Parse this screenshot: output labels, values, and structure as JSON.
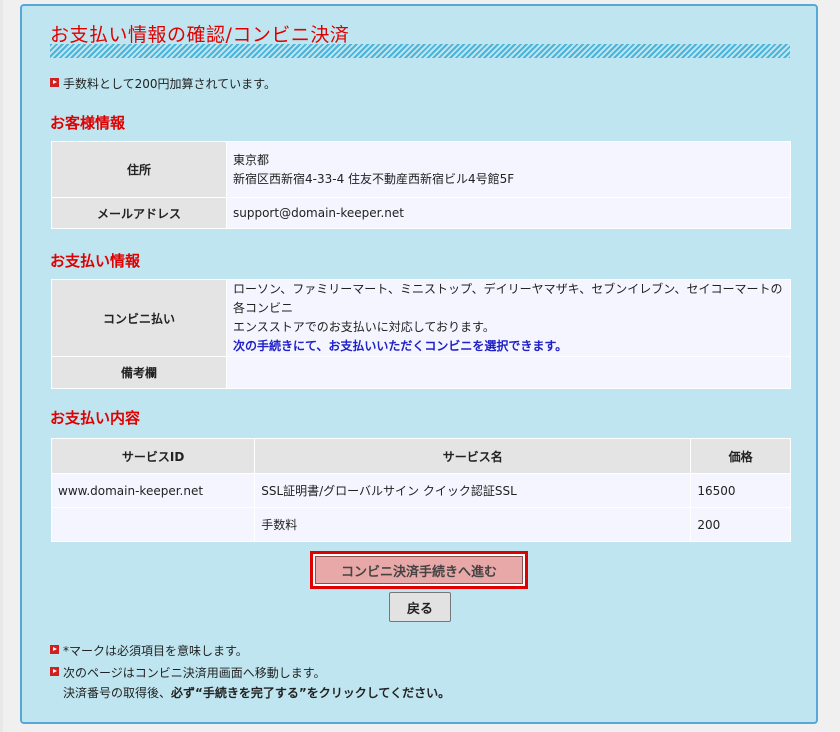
{
  "page": {
    "title": "お支払い情報の確認/コンビニ決済",
    "fee_note": "手数料として200円加算されています。"
  },
  "customer": {
    "heading": "お客様情報",
    "address_label": "住所",
    "address_line1": "東京都",
    "address_line2": "新宿区西新宿4-33-4 住友不動産西新宿ビル4号館5F",
    "email_label": "メールアドレス",
    "email_value": "support@domain-keeper.net"
  },
  "payment": {
    "heading": "お支払い情報",
    "method_label": "コンビニ払い",
    "method_text1": "ローソン、ファミリーマート、ミニストップ、デイリーヤマザキ、セブンイレブン、セイコーマートの各コンビニ",
    "method_text2": "エンスストアでのお支払いに対応しております。",
    "method_highlight": "次の手続きにて、お支払いいただくコンビニを選択できます。",
    "remarks_label": "備考欄",
    "remarks_value": ""
  },
  "content": {
    "heading": "お支払い内容",
    "columns": [
      "サービスID",
      "サービス名",
      "価格"
    ],
    "rows": [
      {
        "id": "www.domain-keeper.net",
        "name": "SSL証明書/グローバルサイン クイック認証SSL",
        "price": "16500"
      },
      {
        "id": "",
        "name": "手数料",
        "price": "200"
      }
    ]
  },
  "actions": {
    "proceed_label": "コンビニ決済手続きへ進む",
    "back_label": "戻る"
  },
  "footer": {
    "note1": "*マークは必須項目を意味します。",
    "note2_line1": "次のページはコンビニ決済用画面へ移動します。",
    "note2_line2_a": "決済番号の取得後、",
    "note2_line2_b": "必ず“手続きを完了する”をクリックしてください。"
  },
  "colors": {
    "panel_bg": "#bfe6f0",
    "panel_border": "#57a8d6",
    "heading_red": "#e00000",
    "highlight_blue": "#2020c8",
    "button_bg": "#e8a8a8"
  }
}
